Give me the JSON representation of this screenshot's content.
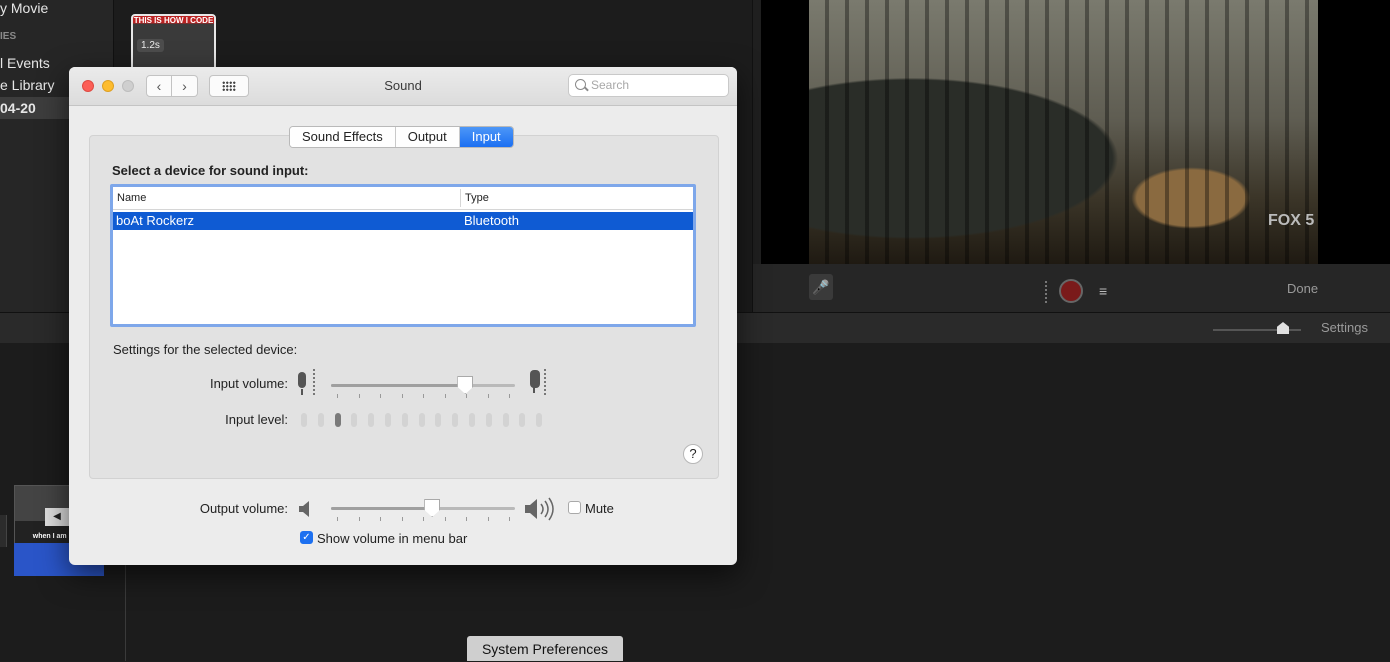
{
  "imovie": {
    "sidebar_items": [
      "y Movie",
      "IES",
      "l Events",
      "e Library",
      "04-20"
    ],
    "clip_title": "THIS IS HOW I CODE",
    "clip_duration": "1.2s",
    "done_label": "Done",
    "settings_label": "Settings",
    "watermark": "FOX 5",
    "timeline_clip_caption": "when I am in the",
    "tooltip": "System Preferences"
  },
  "window": {
    "title": "Sound",
    "search_placeholder": "Search"
  },
  "tabs": [
    {
      "label": "Sound Effects",
      "active": false
    },
    {
      "label": "Output",
      "active": false
    },
    {
      "label": "Input",
      "active": true
    }
  ],
  "input": {
    "select_label": "Select a device for sound input:",
    "columns": {
      "name": "Name",
      "type": "Type"
    },
    "devices": [
      {
        "name": "boAt Rockerz",
        "type": "Bluetooth",
        "selected": true
      }
    ],
    "settings_label": "Settings for the selected device:",
    "volume_label": "Input volume:",
    "volume": 0.73,
    "level_label": "Input level:",
    "level_segments": 15,
    "level_active": [
      3
    ]
  },
  "output": {
    "volume_label": "Output volume:",
    "volume": 0.55,
    "mute_label": "Mute",
    "mute_checked": false,
    "show_in_menu_label": "Show volume in menu bar",
    "show_in_menu_checked": true
  },
  "help_label": "?",
  "colors": {
    "accent": "#1b6ff2",
    "selection": "#0f5bd3",
    "close": "#fc5f57",
    "minimize": "#fdbc2e"
  }
}
